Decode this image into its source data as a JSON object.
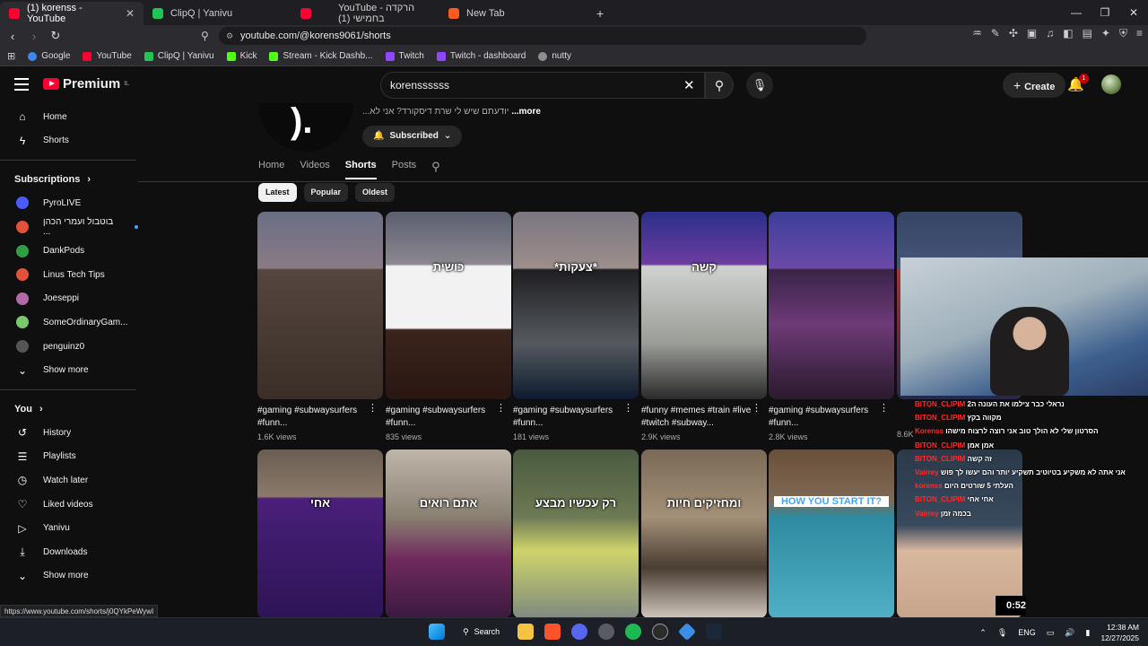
{
  "browser": {
    "tabs": [
      {
        "title": "(1) korenss - YouTube",
        "active": true,
        "color": "#ff0033"
      },
      {
        "title": "ClipQ | Yanivu",
        "active": false,
        "color": "#23c552"
      },
      {
        "title": "YouTube - הרקדה בחמישי (1)",
        "active": false,
        "color": "#ff0033"
      },
      {
        "title": "New Tab",
        "active": false,
        "color": "#ff5a1f"
      }
    ],
    "new_tab": "+",
    "url": "youtube.com/@korens9061/shorts",
    "bookmarks": [
      {
        "label": "Google",
        "color": "#4285f4"
      },
      {
        "label": "YouTube",
        "color": "#ff0033"
      },
      {
        "label": "ClipQ | Yanivu",
        "color": "#23c552"
      },
      {
        "label": "Kick",
        "color": "#53fc18"
      },
      {
        "label": "Stream - Kick Dashb...",
        "color": "#53fc18"
      },
      {
        "label": "Twitch",
        "color": "#9146ff"
      },
      {
        "label": "Twitch - dashboard",
        "color": "#9146ff"
      },
      {
        "label": "nutty",
        "color": "#8e8e8e"
      }
    ]
  },
  "masthead": {
    "logo": "Premium",
    "logo_region": "IL",
    "search_value": "korenssssss",
    "create_label": "Create",
    "notification_count": "1"
  },
  "sidebar": {
    "main": [
      {
        "label": "Home",
        "icon": "home-icon",
        "glyph": "⌂"
      },
      {
        "label": "Shorts",
        "icon": "shorts-icon",
        "glyph": "⚡"
      }
    ],
    "subscriptions_label": "Subscriptions",
    "subscriptions": [
      {
        "label": "PyroLIVE",
        "color": "#4b5cff"
      },
      {
        "label": "בוטבול ועמרי הכהן ...",
        "color": "#e0533a",
        "live": true
      },
      {
        "label": "DankPods",
        "color": "#2ea043"
      },
      {
        "label": "Linus Tech Tips",
        "color": "#e0533a"
      },
      {
        "label": "Joeseppi",
        "color": "#b06aa8"
      },
      {
        "label": "SomeOrdinaryGam...",
        "color": "#7bc96f"
      },
      {
        "label": "penguinz0",
        "color": "#555555"
      }
    ],
    "show_more": "Show more",
    "you_label": "You",
    "you_items": [
      {
        "label": "History",
        "glyph": "↺"
      },
      {
        "label": "Playlists",
        "glyph": "☰"
      },
      {
        "label": "Watch later",
        "glyph": "◷"
      },
      {
        "label": "Liked videos",
        "glyph": "👍"
      },
      {
        "label": "Yanivu",
        "glyph": "▶"
      },
      {
        "label": "Downloads",
        "glyph": "⤓"
      }
    ],
    "show_more_2": "Show more"
  },
  "channel": {
    "description_rtl": "...יודעתם שיש לי שרת דיסקורד? אני לא",
    "more": "...more",
    "subscribed": "Subscribed",
    "tabs": [
      "Home",
      "Videos",
      "Shorts",
      "Posts"
    ],
    "active_tab": "Shorts",
    "chips": [
      "Latest",
      "Popular",
      "Oldest"
    ],
    "active_chip": "Latest"
  },
  "shorts_row1": [
    {
      "caption": "",
      "title": "#gaming #subwaysurfers #funn...",
      "views": "1.6K views",
      "bg": "linear-gradient(180deg,#6b6f84 0%,#8a7a86 30%,#55463f 31%,#3a2e28 100%)"
    },
    {
      "caption": "כושית",
      "title": "#gaming #subwaysurfers #funn...",
      "views": "835 views",
      "bg": "linear-gradient(180deg,#5a5f6f 0%,#8c8790 28%,#f2f2f2 29%,#f2f2f2 62%,#3b241c 63%,#2a1712 100%)"
    },
    {
      "caption": "*צעקות*",
      "title": "#gaming #subwaysurfers #funn...",
      "views": "181 views",
      "bg": "linear-gradient(180deg,#7a7580 0%,#9c8f8c 30%,#1f1f22 31%,#555a60 70%,#0e1b2e 100%)"
    },
    {
      "caption": "קשה",
      "title": "#funny #memes #train #live #twitch #subway...",
      "views": "2.9K views",
      "bg": "linear-gradient(180deg,#2b2e8a 0%,#6c3ea0 28%,#cfd2cf 29%,#9b9d97 70%,#2a2a2a 100%)"
    },
    {
      "caption": "",
      "title": "#gaming #subwaysurfers #funn...",
      "views": "2.8K views",
      "bg": "linear-gradient(180deg,#3b3f9a 0%,#6b4aa8 30%,#3a2447 31%,#6d3a78 60%,#2a1a2c 100%)"
    },
    {
      "caption": "",
      "title": "",
      "views": "8.6K",
      "bg": "linear-gradient(180deg,#364564 0%,#46557a 30%,#a33535 31%,#25284a 100%)"
    }
  ],
  "shorts_row2": [
    {
      "caption": "אחי",
      "bg": "linear-gradient(180deg,#6a5d52 0%,#8b7a6a 28%,#4a1f7a 29%,#2d1457 100%)"
    },
    {
      "caption": "אתם רואים",
      "bg": "linear-gradient(180deg,#bfb6aa 0%,#8a8072 40%,#6f2a5c 65%,#3b1a3f 100%)"
    },
    {
      "caption": "רק עכשיו מבצע",
      "bg": "linear-gradient(180deg,#4a5a3f 0%,#6d7a55 40%,#cfd36a 60%,#7f8a7f 100%)"
    },
    {
      "caption": "ומחזיקים חיות",
      "bg": "linear-gradient(180deg,#7a6a56 0%,#a39078 40%,#4a3d33 70%,#cfc6bd 100%)"
    },
    {
      "caption": "HOW YOU START IT?",
      "bg": "linear-gradient(180deg,#6a4f3a 0%,#7e6a55 30%,#2e8aa0 40%,#4fb0c4 100%)"
    },
    {
      "caption": "",
      "bg": "linear-gradient(180deg,#2a3a4a 0%,#3a4a5e 45%,#d9b8a0 60%,#c7a58c 100%)"
    }
  ],
  "overlay_chat": [
    {
      "user": "BITON_CLIPIM",
      "msg": "נראלי כבר צילמו את העונה ה2"
    },
    {
      "user": "BITON_CLIPIM",
      "msg": "מקווה בקץ"
    },
    {
      "user": "Korenss",
      "msg": "הסרטון שלי לא הולך טוב אני רוצה לרצוח מישהו"
    },
    {
      "user": "BITON_CLIPIM",
      "msg": "אמן אמן"
    },
    {
      "user": "BITON_CLIPIM",
      "msg": "זה קשה"
    },
    {
      "user": "Vairrey",
      "msg": "אני אתה לא משקיע בטיוטיב תשקיע יותר והם יעשו לך פוש"
    },
    {
      "user": "korenss",
      "msg": "העלתי 5 שורטים היום"
    },
    {
      "user": "BITON_CLIPIM",
      "msg": "אחי אחי"
    },
    {
      "user": "Vairrey",
      "msg": "בכמה זמן"
    }
  ],
  "overlay_timer": "0:52",
  "status_url": "https://www.youtube.com/shorts/j0QYkPeWywI",
  "taskbar": {
    "search": "Search",
    "lang": "ENG",
    "time": "12:38 AM",
    "date": "12/27/2025"
  }
}
